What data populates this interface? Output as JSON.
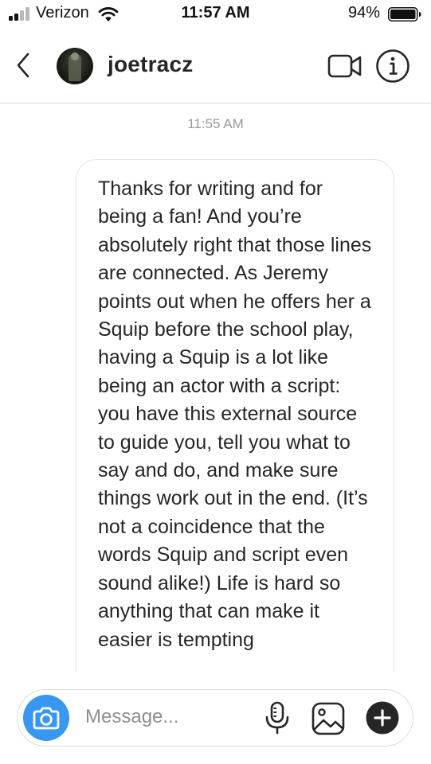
{
  "status_bar": {
    "carrier": "Verizon",
    "time": "11:57 AM",
    "battery_percent": "94%",
    "signal_bars_filled": 2,
    "signal_bars_total": 4,
    "battery_level": 0.94
  },
  "header": {
    "username": "joetracz",
    "icons": {
      "back": "chevron-left-icon",
      "avatar": "avatar",
      "video": "video-camera-icon",
      "info": "info-icon"
    }
  },
  "thread": {
    "timestamp": "11:55 AM",
    "messages": [
      {
        "text": "Thanks for writing and for being a fan! And you’re absolutely right that those lines are connected. As Jeremy points out when he offers her a Squip before the school play, having a Squip is a lot like being an actor with a script: you have this external source to guide you, tell you what to say and do, and make sure things work out in the end. (It’s not a coincidence that the words Squip and script even sound alike!) Life is hard so anything that can make it easier is tempting"
      }
    ]
  },
  "composer": {
    "placeholder": "Message...",
    "value": "",
    "icons": {
      "camera": "camera-icon",
      "mic": "microphone-icon",
      "gallery": "gallery-icon",
      "plus": "plus-icon"
    },
    "accent_color": "#3897f0"
  }
}
